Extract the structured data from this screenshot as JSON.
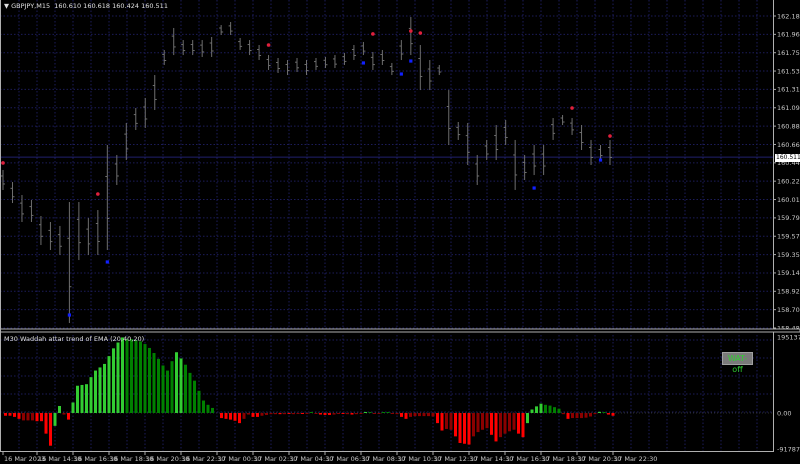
{
  "header": {
    "symbol_caret": "▼",
    "title": "GBPJPY,M15  160.610 160.618 160.424 160.511"
  },
  "indicator": {
    "title": "M30 Waddah attar trend of EMA (20,40,20)",
    "button_label": "WAT-off",
    "button_text_color": "#30d030"
  },
  "current_price_label": "160.511",
  "colors": {
    "background": "#000000",
    "grid": "#1c1c5a",
    "bars": "#6e6e6e",
    "sell_dot": "#e0203c",
    "buy_dot": "#1020ff",
    "current_line": "#20206e",
    "hist_up_strong": "#32cd32",
    "hist_up_weak": "#008000",
    "hist_down_strong": "#ff0000",
    "hist_down_weak": "#8b0000"
  },
  "chart_data": [
    {
      "type": "ohlc",
      "ylim": [
        158.485,
        162.185
      ],
      "y_ticks": [
        "162.185",
        "161.965",
        "161.750",
        "161.530",
        "161.315",
        "161.095",
        "160.880",
        "160.660",
        "160.445",
        "160.225",
        "160.010",
        "159.790",
        "159.575",
        "159.355",
        "159.140",
        "158.920",
        "158.705",
        "158.485"
      ],
      "current_price": 160.511,
      "bars_high_low": [
        [
          160.359,
          160.122
        ],
        [
          160.216,
          159.967
        ],
        [
          160.062,
          159.742
        ],
        [
          160.003,
          159.742
        ],
        [
          159.813,
          159.469
        ],
        [
          159.742,
          159.41
        ],
        [
          159.695,
          159.351
        ],
        [
          159.979,
          158.544
        ],
        [
          159.979,
          159.291
        ],
        [
          159.789,
          159.351
        ],
        [
          159.884,
          159.351
        ],
        [
          160.655,
          159.41
        ],
        [
          160.537,
          160.181
        ],
        [
          160.916,
          160.477
        ],
        [
          161.094,
          160.833
        ],
        [
          161.213,
          160.857
        ],
        [
          161.485,
          161.07
        ],
        [
          161.782,
          161.604
        ],
        [
          162.043,
          161.722
        ],
        [
          161.9,
          161.722
        ],
        [
          161.9,
          161.722
        ],
        [
          161.9,
          161.699
        ],
        [
          161.936,
          161.699
        ],
        [
          162.078,
          161.96
        ],
        [
          162.114,
          161.96
        ],
        [
          161.924,
          161.782
        ],
        [
          161.9,
          161.722
        ],
        [
          161.841,
          161.663
        ],
        [
          161.722,
          161.545
        ],
        [
          161.687,
          161.509
        ],
        [
          161.663,
          161.485
        ],
        [
          161.687,
          161.521
        ],
        [
          161.663,
          161.485
        ],
        [
          161.687,
          161.545
        ],
        [
          161.699,
          161.568
        ],
        [
          161.722,
          161.568
        ],
        [
          161.746,
          161.604
        ],
        [
          161.841,
          161.663
        ],
        [
          161.877,
          161.722
        ],
        [
          161.758,
          161.545
        ],
        [
          161.782,
          161.604
        ],
        [
          161.628,
          161.485
        ],
        [
          161.9,
          161.663
        ],
        [
          162.173,
          161.722
        ],
        [
          161.841,
          161.307
        ],
        [
          161.663,
          161.307
        ],
        [
          161.604,
          161.485
        ],
        [
          161.307,
          160.655
        ],
        [
          160.928,
          160.715
        ],
        [
          160.916,
          160.418
        ],
        [
          160.537,
          160.181
        ],
        [
          160.715,
          160.477
        ],
        [
          160.892,
          160.477
        ],
        [
          160.952,
          160.655
        ],
        [
          160.715,
          160.122
        ],
        [
          160.537,
          160.24
        ],
        [
          160.655,
          160.299
        ],
        [
          160.655,
          160.299
        ],
        [
          160.975,
          160.715
        ],
        [
          161.011,
          160.892
        ],
        [
          160.975,
          160.774
        ],
        [
          160.892,
          160.596
        ],
        [
          160.715,
          160.418
        ],
        [
          160.655,
          160.477
        ],
        [
          160.715,
          160.418
        ]
      ],
      "sell_signals": [
        {
          "bar": 0,
          "price": 160.442
        },
        {
          "bar": 10,
          "price": 160.074
        },
        {
          "bar": 28,
          "price": 161.841
        },
        {
          "bar": 39,
          "price": 161.972
        },
        {
          "bar": 43,
          "price": 162.007
        },
        {
          "bar": 44,
          "price": 161.983
        },
        {
          "bar": 60,
          "price": 161.094
        },
        {
          "bar": 64,
          "price": 160.762
        }
      ],
      "buy_signals": [
        {
          "bar": 7,
          "price": 158.639
        },
        {
          "bar": 11,
          "price": 159.268
        },
        {
          "bar": 38,
          "price": 161.628
        },
        {
          "bar": 42,
          "price": 161.497
        },
        {
          "bar": 43,
          "price": 161.651
        },
        {
          "bar": 56,
          "price": 160.145
        },
        {
          "bar": 63,
          "price": 160.477
        }
      ]
    },
    {
      "type": "bar",
      "ylim": [
        -91787.82,
        195137.79
      ],
      "y_ticks": [
        "195137.79",
        "0.00",
        "-91787.82"
      ],
      "values_thousands": [
        -7,
        -7,
        -10,
        -15,
        -19,
        -19,
        -19,
        -21,
        -21,
        -53,
        -84,
        -33,
        18,
        -4,
        -17,
        27,
        70,
        72,
        74,
        92,
        109,
        117,
        126,
        146,
        166,
        181,
        194,
        190,
        190,
        187,
        184,
        177,
        167,
        154,
        139,
        122,
        109,
        133,
        156,
        140,
        124,
        103,
        83,
        57,
        32,
        21,
        13,
        0,
        -13,
        -15,
        -17,
        -20,
        -26,
        -15,
        -4,
        -10,
        -10,
        -7,
        -5,
        -3,
        -3,
        -3,
        -3,
        -2,
        -3,
        -2,
        -1,
        -2,
        1,
        -2,
        -4,
        -5,
        -5,
        -4,
        -2,
        -2,
        -3,
        -4,
        -3,
        -2,
        1,
        1,
        -1,
        -2,
        1,
        1,
        -2,
        -3,
        -10,
        -15,
        -10,
        -8,
        -8,
        -8,
        -8,
        -9,
        -26,
        -45,
        -41,
        -43,
        -60,
        -77,
        -79,
        -81,
        -60,
        -49,
        -43,
        -39,
        -56,
        -73,
        -62,
        -53,
        -47,
        -43,
        -53,
        -62,
        -26,
        9,
        17,
        24,
        21,
        19,
        15,
        11,
        -3,
        -15,
        -13,
        -13,
        -13,
        -12,
        -9,
        -3,
        3,
        2,
        -4,
        -7
      ],
      "bar_colors": "RRRRrrrRRRRGGrRGGGGGGGGGGGGgggggggggggGGgggggggnRRRRRrrRRrrrrRrRrrRrgrRRRrrRrRrrGgrrggrrRRrrrrrrRRrrRRRRrrrrRRrrrrRRGGGGggggrRrrrrrrGgRR",
      "bar_color_key": {
        "G": "rising up",
        "g": "falling up",
        "R": "rising down",
        "r": "falling down"
      }
    }
  ],
  "x_axis": {
    "ticks": [
      "16 Mar 2023",
      "16 Mar 14:30",
      "16 Mar 16:30",
      "16 Mar 18:30",
      "16 Mar 20:30",
      "16 Mar 22:30",
      "17 Mar 00:30",
      "17 Mar 02:30",
      "17 Mar 04:30",
      "17 Mar 06:30",
      "17 Mar 08:30",
      "17 Mar 10:30",
      "17 Mar 12:30",
      "17 Mar 14:30",
      "17 Mar 16:30",
      "17 Mar 18:30",
      "17 Mar 20:30",
      "17 Mar 22:30"
    ]
  }
}
